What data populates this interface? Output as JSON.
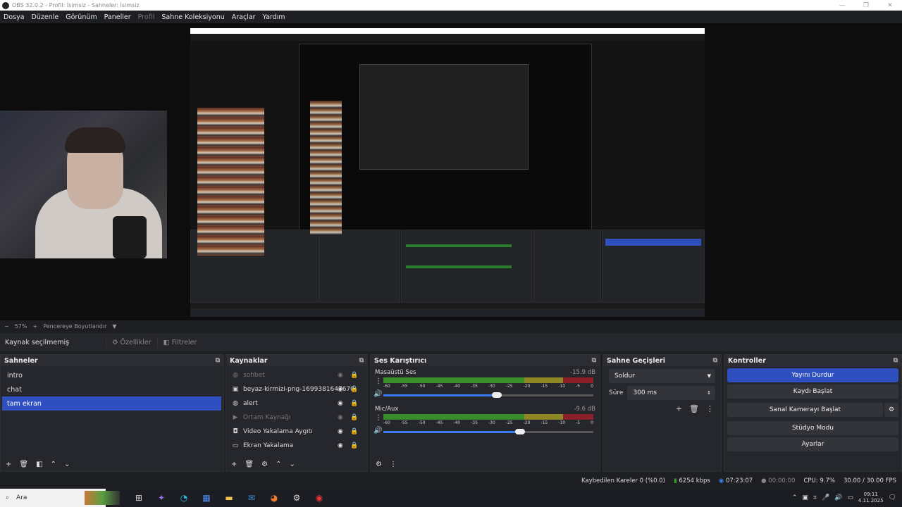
{
  "window": {
    "title": "OBS 32.0.2 - Profil: İsimsiz - Sahneler: İsimsiz",
    "min": "—",
    "restore": "❐",
    "close": "✕"
  },
  "menu": [
    "Dosya",
    "Düzenle",
    "Görünüm",
    "Paneller",
    "Profil",
    "Sahne Koleksiyonu",
    "Araçlar",
    "Yardım"
  ],
  "zoom": {
    "minus": "−",
    "value": "57%",
    "plus": "+",
    "fit_label": "Pencereye Boyutlandır",
    "caret": "▼"
  },
  "source_bar": {
    "status": "Kaynak seçilmemiş",
    "properties": "Özellikler",
    "filters": "Filtreler"
  },
  "scenes": {
    "title": "Sahneler",
    "items": [
      {
        "label": "intro",
        "selected": false
      },
      {
        "label": "chat",
        "selected": false
      },
      {
        "label": "tam ekran",
        "selected": true
      }
    ]
  },
  "sources": {
    "title": "Kaynaklar",
    "items": [
      {
        "label": "sohbet",
        "icon": "globe-icon",
        "dim": true
      },
      {
        "label": "beyaz-kirmizi-png-1699381647670",
        "icon": "image-icon",
        "dim": false
      },
      {
        "label": "alert",
        "icon": "globe-icon",
        "dim": false
      },
      {
        "label": "Ortam Kaynağı",
        "icon": "play-icon",
        "dim": true
      },
      {
        "label": "Video Yakalama Aygıtı",
        "icon": "camera-icon",
        "dim": false
      },
      {
        "label": "Ekran Yakalama",
        "icon": "monitor-icon",
        "dim": false
      }
    ]
  },
  "mixer": {
    "title": "Ses Karıştırıcı",
    "scale": [
      "-60",
      "-55",
      "-50",
      "-45",
      "-40",
      "-35",
      "-30",
      "-25",
      "-20",
      "-15",
      "-10",
      "-5",
      "0"
    ],
    "channels": [
      {
        "name": "Masaüstü Ses",
        "db": "-15.9 dB",
        "volume_fraction": 0.54
      },
      {
        "name": "Mic/Aux",
        "db": "-9.6 dB",
        "volume_fraction": 0.65
      }
    ]
  },
  "transitions": {
    "title": "Sahne Geçişleri",
    "selected": "Soldur",
    "duration_label": "Süre",
    "duration": "300 ms"
  },
  "controls": {
    "title": "Kontroller",
    "stop_stream": "Yayını Durdur",
    "start_record": "Kaydı Başlat",
    "start_virtualcam": "Sanal Kamerayı Başlat",
    "studio_mode": "Stüdyo Modu",
    "settings": "Ayarlar"
  },
  "status": {
    "dropped": "Kaybedilen Kareler 0 (%0.0)",
    "bitrate": "6254 kbps",
    "stream_time": "07:23:07",
    "record_time": "00:00:00",
    "cpu": "CPU: 9.7%",
    "fps": "30.00 / 30.00 FPS"
  },
  "taskbar": {
    "search": "Ara",
    "time": "09:11",
    "date": "4.11.2025"
  },
  "colors": {
    "accent": "#2e4fbd",
    "meter_green": "#3a8e2a",
    "meter_yellow": "#8f8723",
    "meter_red": "#8c1f2a"
  }
}
